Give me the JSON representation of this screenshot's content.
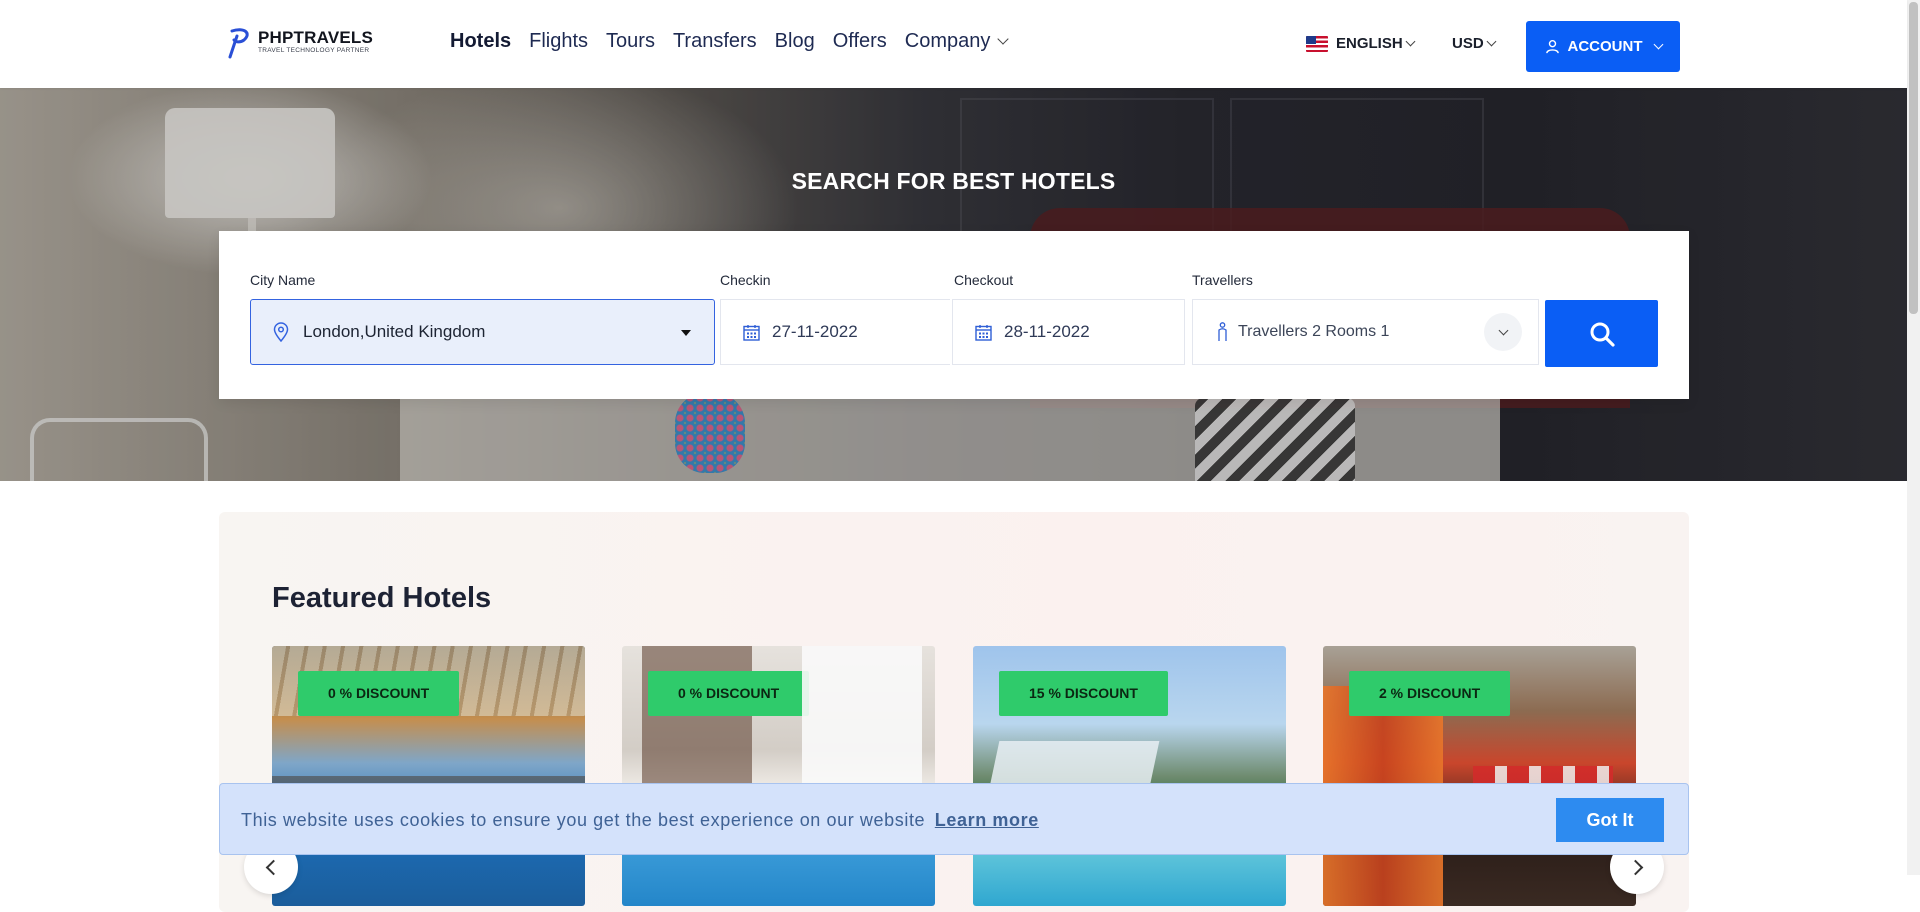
{
  "header": {
    "logo_name": "PHPTRAVELS",
    "logo_tagline": "TRAVEL TECHNOLOGY PARTNER",
    "nav": [
      {
        "label": "Hotels",
        "active": true
      },
      {
        "label": "Flights"
      },
      {
        "label": "Tours"
      },
      {
        "label": "Transfers"
      },
      {
        "label": "Blog"
      },
      {
        "label": "Offers"
      },
      {
        "label": "Company",
        "has_dropdown": true
      }
    ],
    "language": "ENGLISH",
    "currency": "USD",
    "account_label": "ACCOUNT",
    "accent_color": "#0a5ef5"
  },
  "hero": {
    "title": "SEARCH FOR BEST HOTELS"
  },
  "search": {
    "city_label": "City Name",
    "city_value": "London,United Kingdom",
    "checkin_label": "Checkin",
    "checkin_value": "27-11-2022",
    "checkout_label": "Checkout",
    "checkout_value": "28-11-2022",
    "travellers_label": "Travellers",
    "travellers_value": "Travellers 2 Rooms 1",
    "search_icon": "search-icon"
  },
  "featured": {
    "title": "Featured Hotels",
    "cards": [
      {
        "discount": "0 % DISCOUNT"
      },
      {
        "discount": "0 % DISCOUNT"
      },
      {
        "discount": "15 % DISCOUNT"
      },
      {
        "discount": "2 % DISCOUNT"
      }
    ],
    "badge_color": "#2fcb6b"
  },
  "cookie": {
    "text": "This website uses cookies to ensure you get the best experience on our website",
    "link": "Learn more",
    "button": "Got It"
  }
}
